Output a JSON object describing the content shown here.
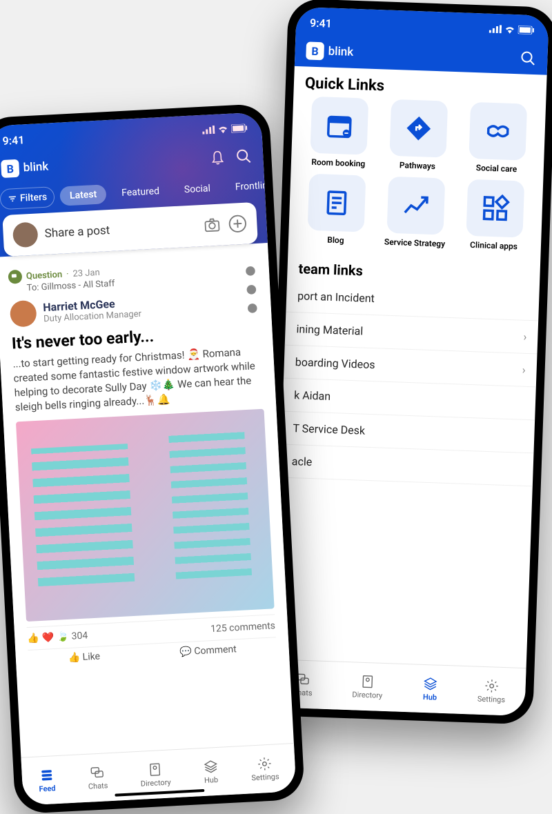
{
  "status_time": "9:41",
  "app_name": "blink",
  "phone_back": {
    "quick_links_title": "Quick Links",
    "tiles": [
      {
        "label": "Room booking",
        "icon": "calendar"
      },
      {
        "label": "Pathways",
        "icon": "diamond-turn"
      },
      {
        "label": "Social care",
        "icon": "handshake"
      },
      {
        "label": "Blog",
        "icon": "document"
      },
      {
        "label": "Service Strategy",
        "icon": "trend"
      },
      {
        "label": "Clinical apps",
        "icon": "grid"
      }
    ],
    "team_links_title": "team links",
    "team_links": [
      {
        "label": "port an Incident",
        "chevron": false
      },
      {
        "label": "ining Material",
        "chevron": true
      },
      {
        "label": "boarding Videos",
        "chevron": true
      },
      {
        "label": "k Aidan",
        "chevron": false
      },
      {
        "label": "T Service Desk",
        "chevron": false
      },
      {
        "label": "acle",
        "chevron": false
      }
    ],
    "nav": [
      {
        "label": "Chats",
        "icon": "chats"
      },
      {
        "label": "Directory",
        "icon": "directory"
      },
      {
        "label": "Hub",
        "icon": "hub",
        "active": true
      },
      {
        "label": "Settings",
        "icon": "settings"
      }
    ]
  },
  "phone_front": {
    "filters": "Filters",
    "tabs": [
      "Latest",
      "Featured",
      "Social",
      "Frontlin"
    ],
    "active_tab": "Latest",
    "composer_placeholder": "Share a post",
    "post": {
      "tag": "Question",
      "date": "23 Jan",
      "to": "To: Gillmoss - All Staff",
      "author": "Harriet McGee",
      "role": "Duty Allocation Manager",
      "title": "It's never too early...",
      "body": "...to start getting ready for Christmas! 🎅 Romana created some fantastic festive window artwork while helping to decorate Sully Day ❄️🎄 We can hear the sleigh bells ringing already...🦌🔔",
      "likes": "304",
      "comments": "125 comments",
      "like_label": "Like",
      "comment_label": "Comment"
    },
    "nav": [
      {
        "label": "Feed",
        "icon": "feed",
        "active": true
      },
      {
        "label": "Chats",
        "icon": "chats"
      },
      {
        "label": "Directory",
        "icon": "directory"
      },
      {
        "label": "Hub",
        "icon": "hub"
      },
      {
        "label": "Settings",
        "icon": "settings"
      }
    ]
  }
}
